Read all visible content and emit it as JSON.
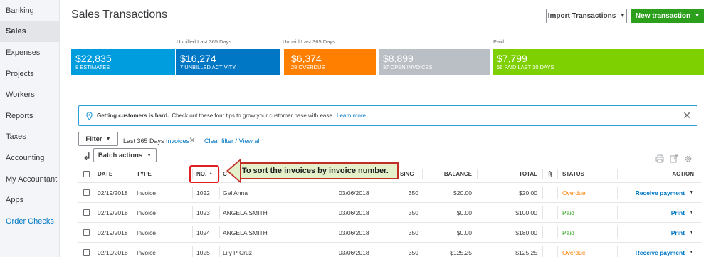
{
  "sidebar": {
    "items": [
      {
        "label": "Banking"
      },
      {
        "label": "Sales"
      },
      {
        "label": "Expenses"
      },
      {
        "label": "Projects"
      },
      {
        "label": "Workers"
      },
      {
        "label": "Reports"
      },
      {
        "label": "Taxes"
      },
      {
        "label": "Accounting"
      },
      {
        "label": "My Accountant"
      },
      {
        "label": "Apps"
      },
      {
        "label": "Order Checks"
      }
    ],
    "active_index": 1
  },
  "header": {
    "title": "Sales Transactions",
    "import_label": "Import Transactions",
    "new_label": "New transaction"
  },
  "money_bar": {
    "unbilled_label": "Unbilled Last 365 Days",
    "unpaid_label": "Unpaid Last 365 Days",
    "paid_label": "Paid",
    "boxes": [
      {
        "amount": "$22,835",
        "sub": "8 ESTIMATES",
        "color": "#009dde"
      },
      {
        "amount": "$16,274",
        "sub": "7 UNBILLED ACTIVITY",
        "color": "#0077c5"
      },
      {
        "amount": "$6,374",
        "sub": "28 OVERDUE",
        "color": "#ff8000"
      },
      {
        "amount": "$8,899",
        "sub": "37 OPEN INVOICES",
        "color": "#babec5"
      },
      {
        "amount": "$7,799",
        "sub": "56 PAID LAST 30 DAYS",
        "color": "#7fd000"
      }
    ]
  },
  "banner": {
    "bold": "Getting customers is hard.",
    "text": "Check out these four tips to grow your customer base with ease.",
    "link": "Learn more."
  },
  "filters": {
    "button": "Filter",
    "range": "Last 365 Days",
    "chip": "Invoices",
    "clear": "Clear filter / View all",
    "batch": "Batch actions"
  },
  "table": {
    "headers": {
      "date": "DATE",
      "type": "TYPE",
      "no": "NO.",
      "customer": "C",
      "due_partial": "SING",
      "balance": "BALANCE",
      "total": "TOTAL",
      "status": "STATUS",
      "action": "ACTION"
    },
    "rows": [
      {
        "date": "02/19/2018",
        "type": "Invoice",
        "no": "1022",
        "customer": "Gel Anna",
        "due_date": "03/06/2018",
        "terms": "350",
        "balance": "$20.00",
        "total": "$20.00",
        "status": "Overdue",
        "status_kind": "overdue",
        "action": "Receive payment"
      },
      {
        "date": "02/19/2018",
        "type": "Invoice",
        "no": "1023",
        "customer": "ANGELA SMITH",
        "due_date": "03/06/2018",
        "terms": "350",
        "balance": "$0.00",
        "total": "$100.00",
        "status": "Paid",
        "status_kind": "paid",
        "action": "Print"
      },
      {
        "date": "02/19/2018",
        "type": "Invoice",
        "no": "1024",
        "customer": "ANGELA SMITH",
        "due_date": "03/06/2018",
        "terms": "350",
        "balance": "$0.00",
        "total": "$180.00",
        "status": "Paid",
        "status_kind": "paid",
        "action": "Print"
      },
      {
        "date": "02/19/2018",
        "type": "Invoice",
        "no": "1025",
        "customer": "Lily P Cruz",
        "due_date": "03/06/2018",
        "terms": "350",
        "balance": "$125.25",
        "total": "$125.25",
        "status": "Overdue",
        "status_kind": "overdue",
        "action": "Receive payment"
      }
    ]
  },
  "callout": {
    "text": "To sort the invoices by invoice number."
  }
}
